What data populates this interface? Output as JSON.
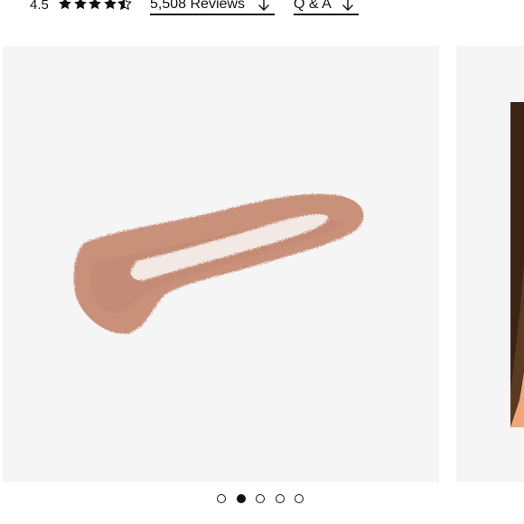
{
  "rating": {
    "value": "4.5",
    "stars_filled": 4.5,
    "stars_total": 5
  },
  "links": {
    "reviews_label": "5,508 Reviews",
    "qa_label": "Q & A"
  },
  "gallery": {
    "slide_count": 5,
    "active_index": 1,
    "main_slide": {
      "kind": "product-swatch",
      "swatch_color": "#c9907a"
    },
    "next_slide": {
      "kind": "model-photo",
      "background_color": "#f1a777"
    }
  },
  "icons": {
    "star": "star-icon",
    "arrow": "arrow-down-icon"
  },
  "colors": {
    "text": "#111111",
    "gallery_bg": "#f6f5f5",
    "accent_orange": "#f1a777"
  }
}
